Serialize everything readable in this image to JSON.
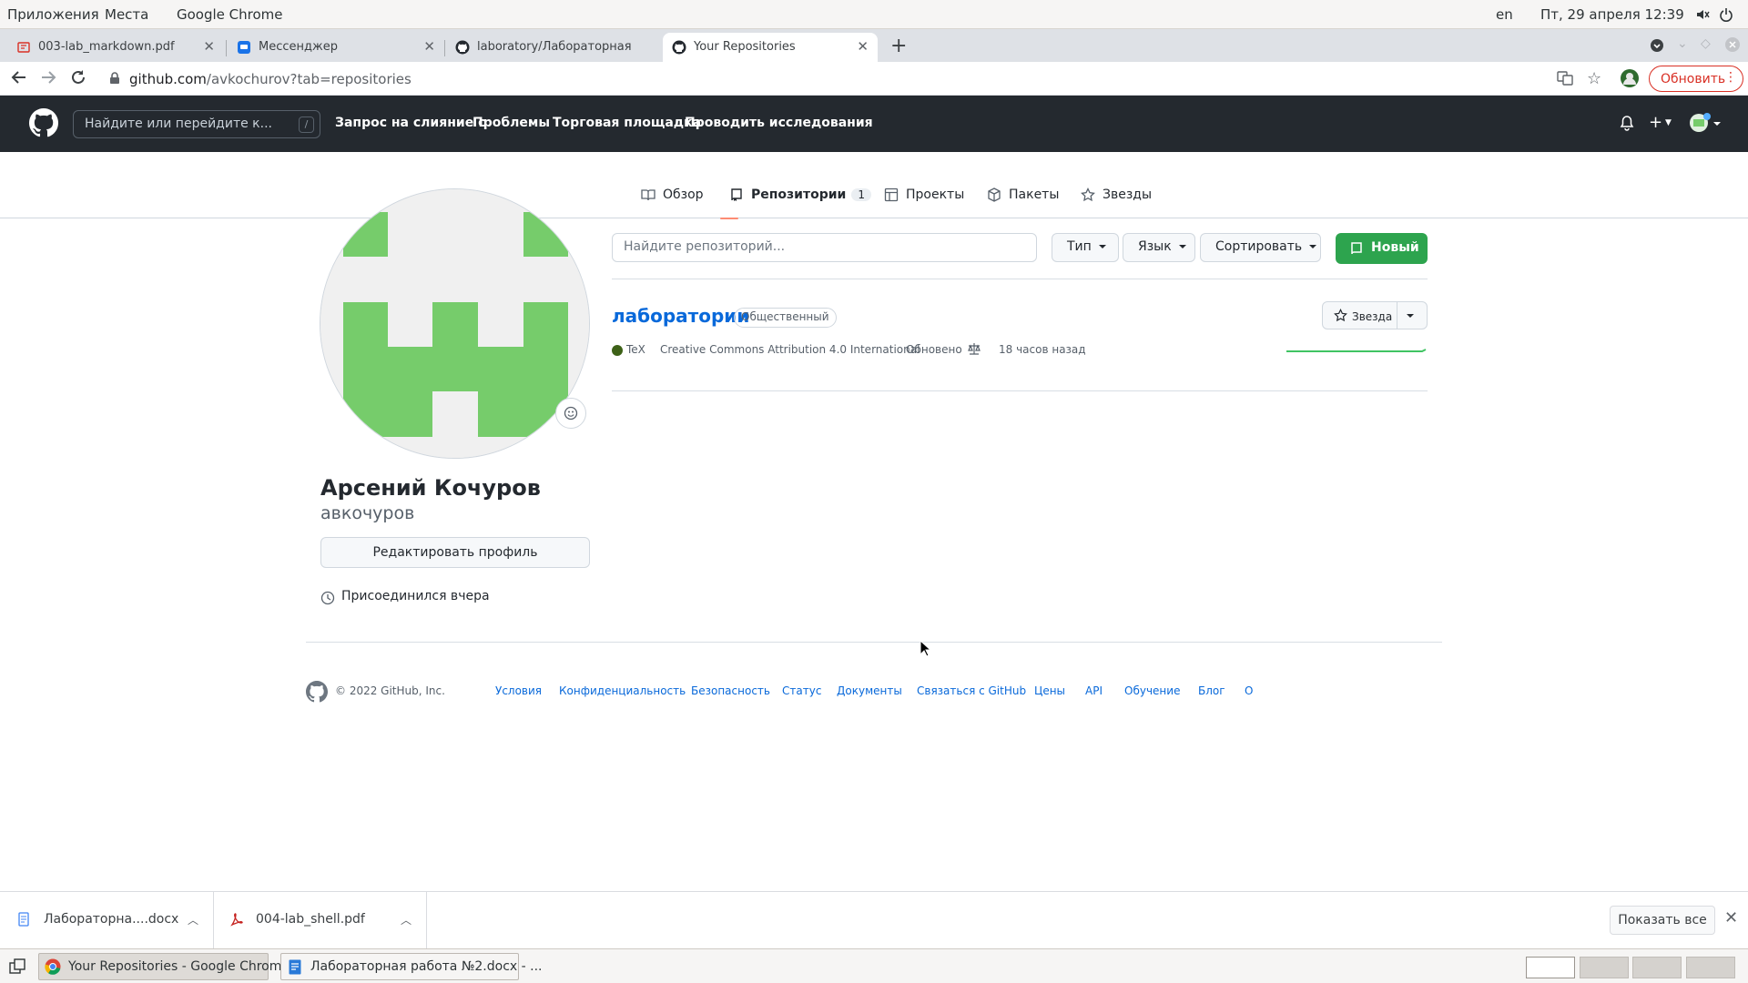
{
  "system_bar": {
    "apps": "Приложения",
    "places": "Места",
    "active_app": "Google Chrome",
    "lang": "en",
    "datetime": "Пт, 29 апреля 12:39"
  },
  "browser": {
    "tabs": [
      {
        "label": "003-lab_markdown.pdf",
        "icon": "pdf-icon"
      },
      {
        "label": "Мессенджер",
        "icon": "messenger-icon"
      },
      {
        "label": "laboratory/Лабораторная ра",
        "icon": "github-icon"
      },
      {
        "label": "Your Repositories",
        "icon": "github-icon",
        "active": true
      }
    ],
    "url_host": "github.com",
    "url_rest": "/avkochurov?tab=repositories",
    "update_label": "Обновить"
  },
  "github": {
    "search_placeholder": "Найдите или перейдите к...",
    "search_shortcut": "/",
    "nav": [
      "Запрос на слияние с",
      "Проблемы",
      "Торговая площадка",
      "Проводить исследования"
    ],
    "profile_tabs": [
      {
        "label": "Обзор",
        "icon": "book-icon"
      },
      {
        "label": "Репозитории",
        "icon": "repo-icon",
        "count": "1",
        "selected": true
      },
      {
        "label": "Проекты",
        "icon": "table-icon"
      },
      {
        "label": "Пакеты",
        "icon": "package-icon"
      },
      {
        "label": "Звезды",
        "icon": "star-icon"
      }
    ],
    "profile": {
      "full_name": "Арсений Кочуров",
      "login": "авкочуров",
      "edit_label": "Редактировать профиль",
      "joined": "Присоединился вчера"
    },
    "repo_filter": {
      "placeholder": "Найдите репозиторий...",
      "type": "Тип",
      "language": "Язык",
      "sort": "Сортировать",
      "new": "Новый"
    },
    "repos": [
      {
        "name": "лаборатории",
        "visibility": "Общественный",
        "language": "TeX",
        "language_color": "#3d6117",
        "license": "Creative Commons Attribution 4.0 International",
        "updated_prefix": "Обновено",
        "updated": "18 часов назад",
        "star_label": "Звезда"
      }
    ],
    "footer": {
      "copyright": "© 2022 GitHub, Inc.",
      "links": [
        "Условия",
        "Конфиденциальность",
        "Безопасность",
        "Статус",
        "Документы",
        "Связаться с GitHub",
        "Цены",
        "API",
        "Обучение",
        "Блог",
        "О"
      ]
    }
  },
  "downloads": {
    "items": [
      {
        "name": "Лабораторна....docx",
        "icon": "docx-icon"
      },
      {
        "name": "004-lab_shell.pdf",
        "icon": "pdf-icon"
      }
    ],
    "show_all": "Показать все"
  },
  "taskbar": {
    "windows": [
      {
        "title": "Your Repositories - Google Chrome",
        "active": true
      },
      {
        "title": "Лабораторная работа №2.docx - ..."
      }
    ]
  },
  "colors": {
    "github_header": "#24292f",
    "accent_green": "#2da44e",
    "link_blue": "#0969da",
    "tab_underline": "#fd8c73"
  }
}
